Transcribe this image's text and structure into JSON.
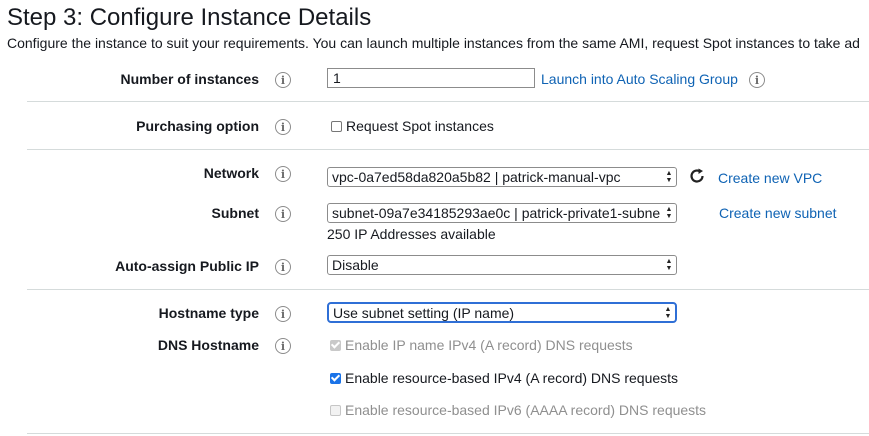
{
  "page": {
    "title": "Step 3: Configure Instance Details",
    "subtitle": "Configure the instance to suit your requirements. You can launch multiple instances from the same AMI, request Spot instances to take ad"
  },
  "info_glyph": "i",
  "number_of_instances": {
    "label": "Number of instances",
    "value": "1",
    "asg_link": "Launch into Auto Scaling Group"
  },
  "purchasing_option": {
    "label": "Purchasing option",
    "spot_label": "Request Spot instances",
    "spot_checked": false
  },
  "network": {
    "label": "Network",
    "selected": "vpc-0a7ed58da820a5b82 | patrick-manual-vpc",
    "refresh_icon": "refresh-icon",
    "create_link": "Create new VPC"
  },
  "subnet": {
    "label": "Subnet",
    "selected": "subnet-09a7e34185293ae0c | patrick-private1-subne",
    "available_note": "250 IP Addresses available",
    "create_link": "Create new subnet"
  },
  "auto_assign_ip": {
    "label": "Auto-assign Public IP",
    "selected": "Disable"
  },
  "hostname_type": {
    "label": "Hostname type",
    "selected": "Use subnet setting (IP name)"
  },
  "dns_hostname": {
    "label": "DNS Hostname",
    "options": [
      {
        "label": "Enable IP name IPv4 (A record) DNS requests",
        "checked": true,
        "disabled": true
      },
      {
        "label": "Enable resource-based IPv4 (A record) DNS requests",
        "checked": true,
        "disabled": false
      },
      {
        "label": "Enable resource-based IPv6 (AAAA record) DNS requests",
        "checked": false,
        "disabled": true
      }
    ]
  },
  "colors": {
    "link": "#0f63b4",
    "focus_border": "#2f6fd6",
    "checkbox_checked": "#1a73e8",
    "divider": "#d5dbdb"
  }
}
